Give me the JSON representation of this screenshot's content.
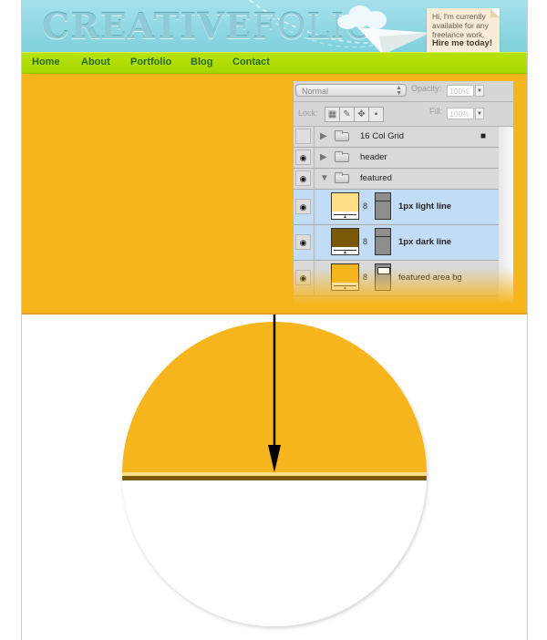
{
  "header": {
    "logo_bold": "CREATIVE",
    "logo_light": "FOLIO",
    "note": {
      "line1": "Hi, I'm currently",
      "line2": "available for any",
      "line3": "freelance work.",
      "cta": "Hire me today!"
    }
  },
  "nav": {
    "items": [
      {
        "label": "Home"
      },
      {
        "label": "About"
      },
      {
        "label": "Portfolio"
      },
      {
        "label": "Blog"
      },
      {
        "label": "Contact"
      }
    ]
  },
  "colors": {
    "featured_bg": "#f6b51d",
    "light_line": "#ffdf86",
    "dark_line": "#7a5806",
    "nav_green": "#aedc00",
    "header_blue": "#8fd5e0"
  },
  "layers_panel": {
    "blend_mode": "Normal",
    "opacity_label": "Opacity:",
    "opacity_value": "100%",
    "lock_label": "Lock:",
    "fill_label": "Fill:",
    "fill_value": "100%",
    "layers": [
      {
        "name": "16 Col Grid",
        "type": "group",
        "visible": false,
        "locked": true,
        "expanded": false
      },
      {
        "name": "header",
        "type": "group",
        "visible": true,
        "expanded": false
      },
      {
        "name": "featured",
        "type": "group",
        "visible": true,
        "expanded": true
      },
      {
        "name": "1px light line",
        "type": "layer",
        "visible": true,
        "selected": true,
        "thumb_color": "#ffdf86"
      },
      {
        "name": "1px dark line",
        "type": "layer",
        "visible": true,
        "selected": true,
        "thumb_color": "#7a5806"
      },
      {
        "name": "featured area bg",
        "type": "layer",
        "visible": true,
        "selected": false,
        "thumb_color": "#f6b51d"
      }
    ]
  },
  "icons": {
    "eye": "👁",
    "lock": "🔒",
    "expand": "▶",
    "collapse": "▼",
    "chain": "⛓",
    "move": "✥",
    "brush": "✎"
  }
}
